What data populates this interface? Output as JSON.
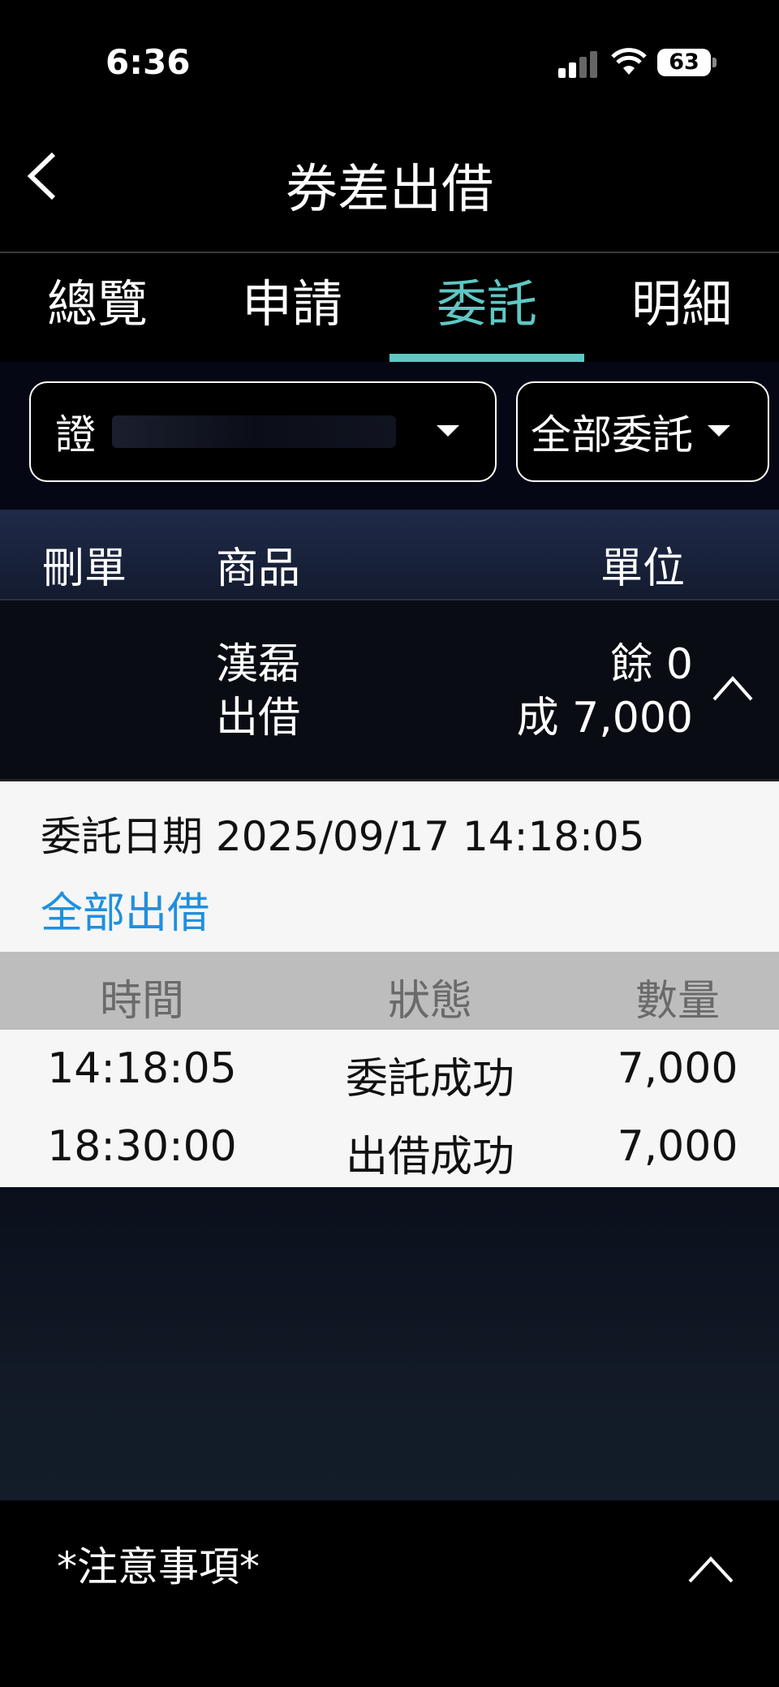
{
  "status_bar": {
    "time": "6:36",
    "battery": "63"
  },
  "header": {
    "title": "券差出借"
  },
  "tabs": [
    {
      "label": "總覽",
      "active": false
    },
    {
      "label": "申請",
      "active": false
    },
    {
      "label": "委託",
      "active": true
    },
    {
      "label": "明細",
      "active": false
    }
  ],
  "filters": {
    "account_prefix": "證",
    "order_type": "全部委託"
  },
  "table_header": {
    "delete": "刪單",
    "product": "商品",
    "unit": "單位"
  },
  "order": {
    "product_name": "漢磊",
    "action": "出借",
    "remaining": "餘 0",
    "filled": "成 7,000"
  },
  "detail": {
    "order_date_label": "委託日期 2025/09/17 14:18:05",
    "lend_all_link": "全部出借",
    "columns": [
      "時間",
      "狀態",
      "數量"
    ],
    "rows": [
      {
        "time": "14:18:05",
        "status": "委託成功",
        "quantity": "7,000"
      },
      {
        "time": "18:30:00",
        "status": "出借成功",
        "quantity": "7,000"
      }
    ]
  },
  "footer": {
    "notes_label": "*注意事項*"
  },
  "colors": {
    "accent": "#5ec8c4",
    "link": "#1e90e0"
  }
}
